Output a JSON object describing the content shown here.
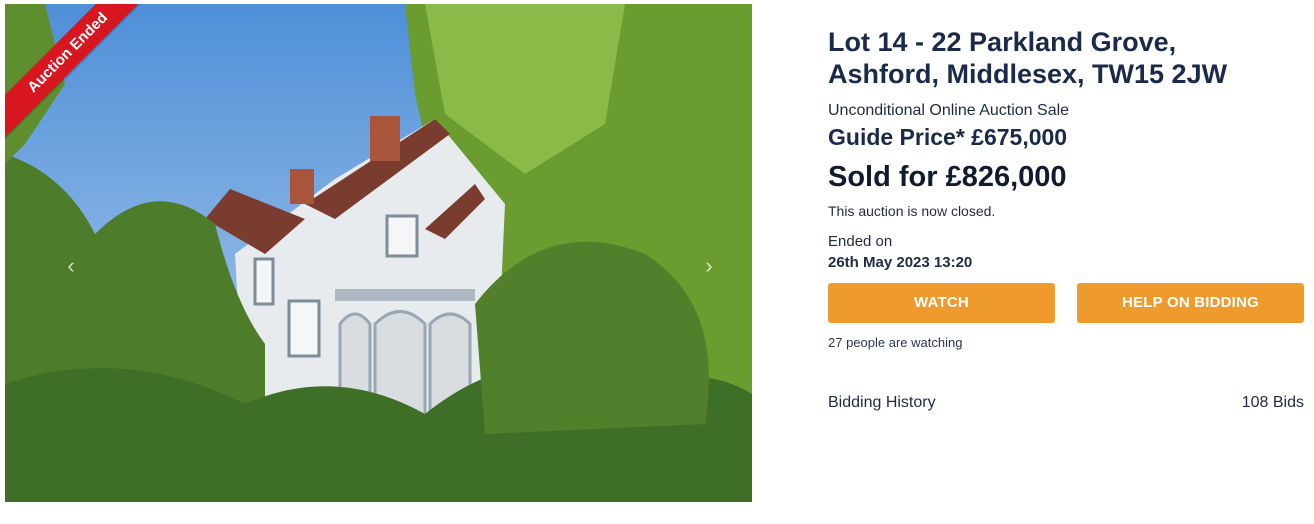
{
  "photo": {
    "ribbon_label": "Auction Ended",
    "prev_icon": "chevron-left-icon",
    "next_icon": "chevron-right-icon"
  },
  "listing": {
    "title_line1": "Lot 14 - 22 Parkland Grove,",
    "title_line2": "Ashford, Middlesex, TW15 2JW",
    "sale_type": "Unconditional Online Auction Sale",
    "guide_price": "Guide Price* £675,000",
    "sold_for": "Sold for £826,000",
    "status_text": "This auction is now closed.",
    "ended_label": "Ended on",
    "ended_date": "26th May 2023 13:20",
    "watch_label": "WATCH",
    "help_label": "HELP ON BIDDING",
    "watching_text": "27 people are watching",
    "bidding_history_label": "Bidding History",
    "bid_count": "108 Bids"
  },
  "colors": {
    "button": "#ef9a2c",
    "ribbon": "#d7161f",
    "heading": "#1b2a4a"
  }
}
